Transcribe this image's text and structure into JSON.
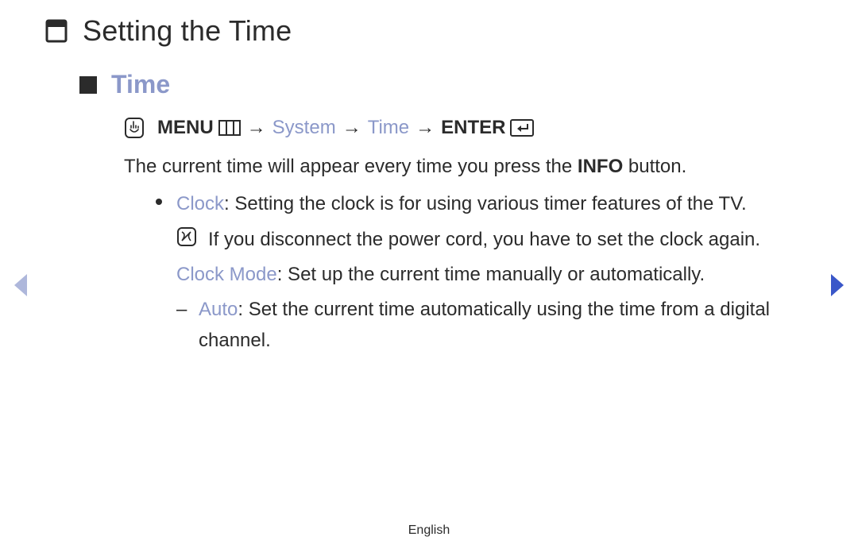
{
  "title": "Setting the Time",
  "subtitle": "Time",
  "breadcrumb": {
    "menu": "MENU",
    "system": "System",
    "time": "Time",
    "enter": "ENTER",
    "arrow": "→"
  },
  "intro_prefix": "The current time will appear every time you press the ",
  "intro_bold": "INFO",
  "intro_suffix": " button.",
  "clock_term": "Clock",
  "clock_desc": ": Setting the clock is for using various timer features of the TV.",
  "note_text": "If you disconnect the power cord, you have to set the clock again.",
  "clockmode_term": "Clock Mode",
  "clockmode_desc": ": Set up the current time manually or automatically.",
  "auto_term": "Auto",
  "auto_desc": ": Set the current time automatically using the time from a digital channel.",
  "dash": "–",
  "footer": "English"
}
